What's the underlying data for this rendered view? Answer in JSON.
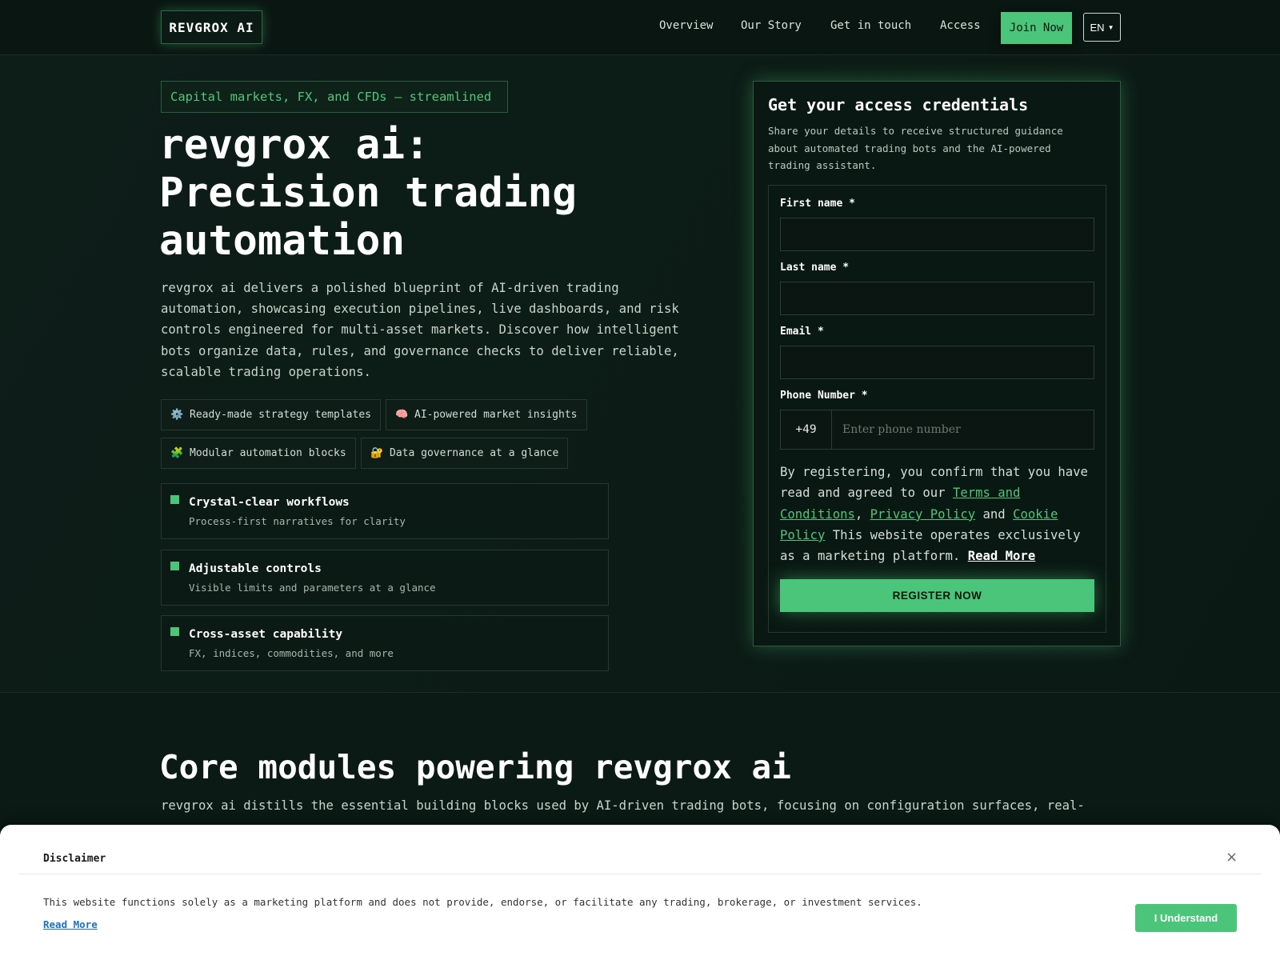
{
  "header": {
    "logo": "REVGROX AI",
    "nav": [
      "Overview",
      "Our Story",
      "Get in touch",
      "Access"
    ],
    "join_label": "Join Now",
    "language": "EN"
  },
  "hero": {
    "badge": "Capital markets, FX, and CFDs — streamlined",
    "title_lines": [
      "revgrox ai:",
      "Precision trading",
      "automation"
    ],
    "description": "revgrox ai delivers a polished blueprint of AI-driven trading automation, showcasing execution pipelines, live dashboards, and risk controls engineered for multi-asset markets. Discover how intelligent bots organize data, rules, and governance checks to deliver reliable, scalable trading operations.",
    "chips": [
      {
        "icon": "⚙️",
        "icon_name": "gear-icon",
        "label": "Ready-made strategy templates"
      },
      {
        "icon": "🧠",
        "icon_name": "brain-icon",
        "label": "AI-powered market insights"
      },
      {
        "icon": "🧩",
        "icon_name": "puzzle-icon",
        "label": "Modular automation blocks"
      },
      {
        "icon": "🔐",
        "icon_name": "lock-icon",
        "label": "Data governance at a glance"
      }
    ],
    "features": [
      {
        "title": "Crystal-clear workflows",
        "subtitle": "Process-first narratives for clarity"
      },
      {
        "title": "Adjustable controls",
        "subtitle": "Visible limits and parameters at a glance"
      },
      {
        "title": "Cross-asset capability",
        "subtitle": "FX, indices, commodities, and more"
      }
    ]
  },
  "form": {
    "title": "Get your access credentials",
    "subtitle": "Share your details to receive structured guidance about automated trading bots and the AI-powered trading assistant.",
    "first_name_label": "First name *",
    "last_name_label": "Last name *",
    "email_label": "Email *",
    "phone_label": "Phone Number *",
    "phone_code": "+49",
    "phone_placeholder": "Enter phone number",
    "legal": {
      "part1": "By registering, you confirm that you have read and agreed to our ",
      "terms": "Terms and Conditions",
      "comma": ", ",
      "privacy": "Privacy Policy",
      "and": " and ",
      "cookie": "Cookie Policy",
      "part2": " This website operates exclusively as a marketing platform. ",
      "read_more": "Read More"
    },
    "submit_label": "REGISTER NOW"
  },
  "section2": {
    "title": "Core modules powering revgrox ai",
    "description": "revgrox ai distills the essential building blocks used by AI-driven trading bots, focusing on configuration surfaces, real-"
  },
  "disclaimer": {
    "title": "Disclaimer",
    "close": "×",
    "text": "This website functions solely as a marketing platform and does not provide, endorse, or facilitate any trading, brokerage, or investment services.",
    "read_more": "Read More",
    "button": "I Understand"
  },
  "colors": {
    "accent": "#4ac579",
    "background": "#0b1a15",
    "link": "#1a73c8"
  }
}
